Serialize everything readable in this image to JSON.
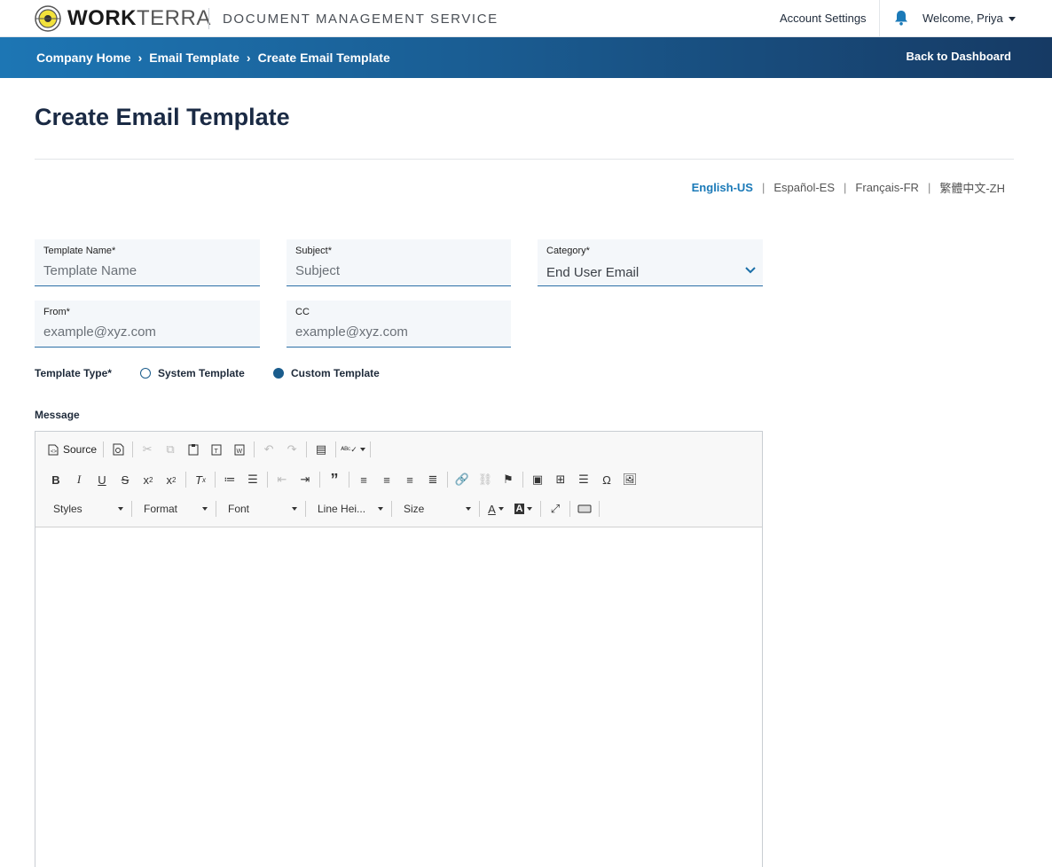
{
  "brand": {
    "logo_work": "WORK",
    "logo_terra": "TERRA",
    "service_name": "DOCUMENT MANAGEMENT SERVICE",
    "accent": "#1b7ab8"
  },
  "header": {
    "account_settings": "Account Settings",
    "welcome": "Welcome, Priya",
    "bell_icon": "bell-icon"
  },
  "breadcrumb": {
    "items": [
      "Company Home",
      "Email Template",
      "Create Email Template"
    ],
    "back_label": "Back to Dashboard"
  },
  "page": {
    "title": "Create Email Template"
  },
  "languages": {
    "items": [
      "English-US",
      "Español-ES",
      "Français-FR",
      "繁體中文-ZH"
    ],
    "active": "English-US"
  },
  "form": {
    "template_name": {
      "label": "Template Name*",
      "placeholder": "Template Name"
    },
    "subject": {
      "label": "Subject*",
      "placeholder": "Subject"
    },
    "category": {
      "label": "Category*",
      "value": "End User Email"
    },
    "from": {
      "label": "From*",
      "placeholder": "example@xyz.com"
    },
    "cc": {
      "label": "CC",
      "placeholder": "example@xyz.com"
    },
    "template_type": {
      "label": "Template Type*",
      "options": [
        "System Template",
        "Custom Template"
      ],
      "selected": "Custom Template"
    },
    "message_label": "Message"
  },
  "editor": {
    "source_label": "Source",
    "combos": [
      "Styles",
      "Format",
      "Font",
      "Line Hei...",
      "Size"
    ]
  }
}
